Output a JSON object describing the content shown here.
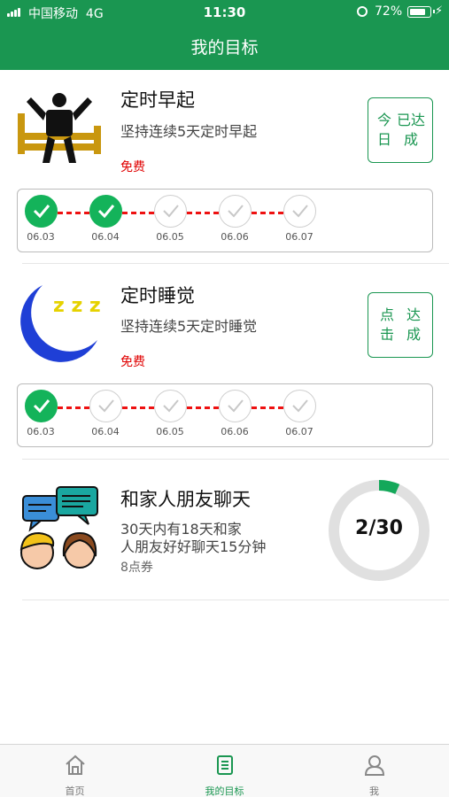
{
  "status_bar": {
    "carrier": "中国移动",
    "network": "4G",
    "time": "11:30",
    "battery": "72%",
    "battery_level": 0.72
  },
  "header": {
    "title": "我的目标"
  },
  "goals": [
    {
      "title": "定时早起",
      "description": "坚持连续5天定时早起",
      "price": "免费",
      "action": "今日已达成",
      "icon": "wake-up-icon",
      "days": [
        {
          "date": "06.03",
          "done": true
        },
        {
          "date": "06.04",
          "done": true
        },
        {
          "date": "06.05",
          "done": false
        },
        {
          "date": "06.06",
          "done": false
        },
        {
          "date": "06.07",
          "done": false
        }
      ]
    },
    {
      "title": "定时睡觉",
      "description": "坚持连续5天定时睡觉",
      "price": "免费",
      "action": "点击达成",
      "icon": "moon-sleep-icon",
      "sleep_text": "z z z",
      "days": [
        {
          "date": "06.03",
          "done": true
        },
        {
          "date": "06.04",
          "done": false
        },
        {
          "date": "06.05",
          "done": false
        },
        {
          "date": "06.06",
          "done": false
        },
        {
          "date": "06.07",
          "done": false
        }
      ]
    },
    {
      "title": "和家人朋友聊天",
      "description": "30天内有18天和家人朋友好好聊天15分钟",
      "reward": "8点券",
      "progress_text": "2/30",
      "progress": 0.0667,
      "icon": "chat-people-icon"
    }
  ],
  "tabs": [
    {
      "label": "首页",
      "icon": "home-icon",
      "active": false
    },
    {
      "label": "我的目标",
      "icon": "goals-list-icon",
      "active": true
    },
    {
      "label": "我",
      "icon": "profile-icon",
      "active": false
    }
  ],
  "colors": {
    "brand_green": "#1a9651",
    "check_green": "#14b35a",
    "price_red": "#e00000",
    "dash_red": "#ee1111"
  }
}
